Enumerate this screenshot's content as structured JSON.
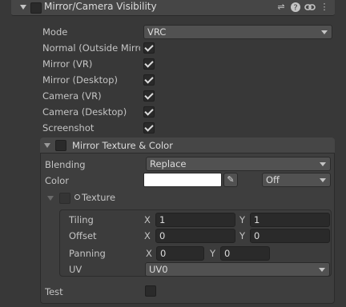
{
  "header": {
    "title": "Mirror/Camera Visibility",
    "enabled": true,
    "icons": [
      "sliders-icon",
      "help-icon",
      "link-icon",
      "more-icon"
    ]
  },
  "mode": {
    "label": "Mode",
    "value": "VRC"
  },
  "visibility_rows": [
    {
      "label": "Normal (Outside Mirro",
      "checked": true
    },
    {
      "label": "Mirror (VR)",
      "checked": true
    },
    {
      "label": "Mirror (Desktop)",
      "checked": true
    },
    {
      "label": "Camera (VR)",
      "checked": true
    },
    {
      "label": "Camera (Desktop)",
      "checked": true
    },
    {
      "label": "Screenshot",
      "checked": true
    }
  ],
  "mirror_texture": {
    "title": "Mirror Texture & Color",
    "enabled": false,
    "blending": {
      "label": "Blending",
      "value": "Replace"
    },
    "color": {
      "label": "Color",
      "swatch": "#ffffff",
      "mode": "Off"
    },
    "texture": {
      "title": "Texture",
      "tiling": {
        "label": "Tiling",
        "x_label": "X",
        "x": "1",
        "y_label": "Y",
        "y": "1"
      },
      "offset": {
        "label": "Offset",
        "x_label": "X",
        "x": "0",
        "y_label": "Y",
        "y": "0"
      },
      "panning": {
        "label": "Panning",
        "x_label": "X",
        "x": "0",
        "y_label": "Y",
        "y": "0"
      },
      "uv": {
        "label": "UV",
        "value": "UV0"
      }
    },
    "test": {
      "label": "Test",
      "checked": false
    }
  }
}
